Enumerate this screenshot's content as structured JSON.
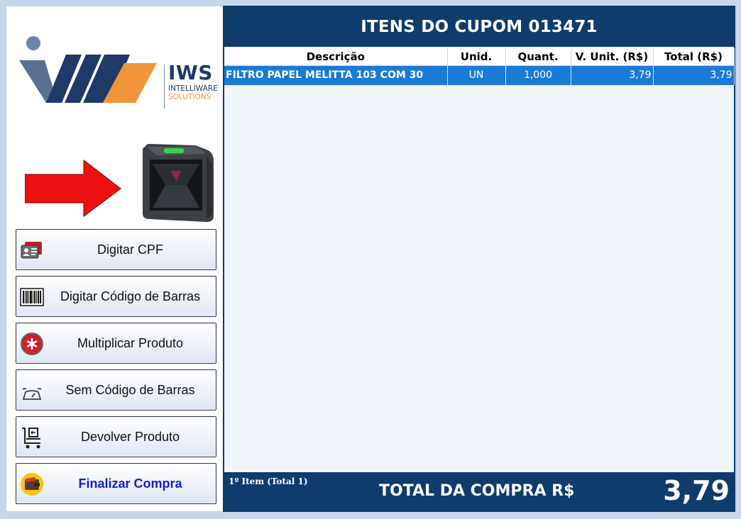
{
  "brand": {
    "name": "IWS",
    "line1": "INTELLIWARE",
    "line2": "SOLUTIONS",
    "colors": {
      "navy": "#1f3a68",
      "orange": "#f2943b"
    }
  },
  "hint": {
    "arrow_color": "#ee1111",
    "device": "barcode-scanner"
  },
  "actions": [
    {
      "id": "cpf",
      "label": "Digitar CPF",
      "icon": "id-card-icon"
    },
    {
      "id": "barcode",
      "label": "Digitar Código de Barras",
      "icon": "barcode-icon"
    },
    {
      "id": "multiply",
      "label": "Multiplicar Produto",
      "icon": "asterisk-icon"
    },
    {
      "id": "noBarcode",
      "label": "Sem Código de Barras",
      "icon": "scale-icon"
    },
    {
      "id": "return",
      "label": "Devolver Produto",
      "icon": "cart-return-icon"
    },
    {
      "id": "finish",
      "label": "Finalizar Compra",
      "icon": "wallet-icon"
    }
  ],
  "cupom": {
    "title": "ITENS DO CUPOM 013471",
    "columns": [
      "Descrição",
      "Unid.",
      "Quant.",
      "V. Unit. (R$)",
      "Total (R$)"
    ],
    "rows": [
      {
        "desc": "FILTRO PAPEL MELITTA 103 COM 30",
        "unit": "UN",
        "qty": "1,000",
        "unit_price": "3,79",
        "total": "3,79"
      }
    ]
  },
  "footer": {
    "count": "1º Item (Total 1)",
    "total_label": "TOTAL DA COMPRA R$",
    "total_value": "3,79"
  },
  "colors": {
    "header_bg": "#0f3b6d",
    "row_selected": "#1a7ad6",
    "finish_label": "#1020c8"
  }
}
